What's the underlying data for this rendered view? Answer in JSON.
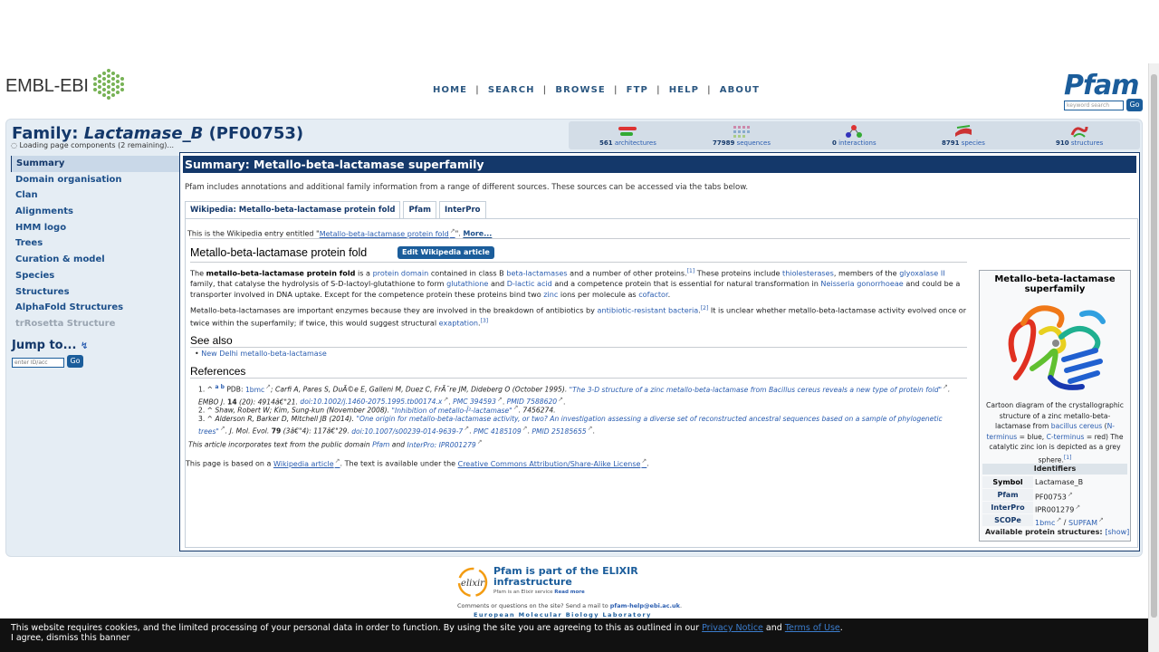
{
  "header": {
    "ebi_logo_text": "EMBL-EBI",
    "nav": [
      "HOME",
      "SEARCH",
      "BROWSE",
      "FTP",
      "HELP",
      "ABOUT"
    ],
    "nav_separator": "|",
    "pfam_logo_text": "Pfam",
    "search_placeholder": "keyword search",
    "search_go": "Go"
  },
  "family": {
    "title_prefix": "Family:",
    "name": "Lactamase_B",
    "accession": "(PF00753)",
    "loading": "Loading page components (2 remaining)..."
  },
  "stats": [
    {
      "count": "561",
      "label": "architectures",
      "icon": "architectures-icon"
    },
    {
      "count": "77989",
      "label": "sequences",
      "icon": "sequences-icon"
    },
    {
      "count": "0",
      "label": "interactions",
      "icon": "interactions-icon"
    },
    {
      "count": "8791",
      "label": "species",
      "icon": "species-icon"
    },
    {
      "count": "910",
      "label": "structures",
      "icon": "structures-icon"
    }
  ],
  "sidebar": {
    "items": [
      {
        "label": "Summary"
      },
      {
        "label": "Domain organisation"
      },
      {
        "label": "Clan"
      },
      {
        "label": "Alignments"
      },
      {
        "label": "HMM logo"
      },
      {
        "label": "Trees"
      },
      {
        "label": "Curation & model"
      },
      {
        "label": "Species"
      },
      {
        "label": "Structures"
      },
      {
        "label": "AlphaFold Structures"
      },
      {
        "label": "trRosetta Structure"
      }
    ],
    "jump_title": "Jump to...",
    "jump_placeholder": "enter ID/acc",
    "jump_go": "Go"
  },
  "main": {
    "heading": "Summary: Metallo-beta-lactamase superfamily",
    "intro": "Pfam includes annotations and additional family information from a range of different sources. These sources can be accessed via the tabs below.",
    "tabs": [
      "Wikipedia: Metallo-beta-lactamase protein fold",
      "Pfam",
      "InterPro"
    ],
    "wiki_entry_prefix": "This is the Wikipedia entry entitled \"",
    "wiki_entry_link": "Metallo-beta-lactamase protein fold",
    "wiki_entry_suffix": "\".",
    "more": "More...",
    "article_title": "Metallo-beta-lactamase protein fold",
    "edit_button": "Edit Wikipedia article",
    "para1": {
      "t1": "The ",
      "b1": "metallo-beta-lactamase protein fold",
      "t2": " is a ",
      "l1": "protein domain",
      "t3": " contained in class B ",
      "l2": "beta-lactamases",
      "t4": " and a number of other proteins.",
      "s1": "[1]",
      "t5": " These proteins include ",
      "l3": "thiolesterases",
      "t6": ", members of the ",
      "l4": "glyoxalase II",
      "t7": " family, that catalyse the hydrolysis of S-D-lactoyl-glutathione to form ",
      "l5": "glutathione",
      "t8": " and ",
      "l6": "D-lactic acid",
      "t9": " and a competence protein that is essential for natural transformation in ",
      "l7": "Neisseria gonorrhoeae",
      "t10": " and could be a transporter involved in DNA uptake. Except for the competence protein these proteins bind two ",
      "l8": "zinc",
      "t11": " ions per molecule as ",
      "l9": "cofactor",
      "t12": "."
    },
    "para2": {
      "t1": "Metallo-beta-lactamases are important enzymes because they are involved in the breakdown of antibiotics by ",
      "l1": "antibiotic-resistant bacteria",
      "t2": ".",
      "s1": "[2]",
      "t3": " It is unclear whether metallo-beta-lactamase activity evolved once or twice within the superfamily; if twice, this would suggest structural ",
      "l2": "exaptation",
      "t4": ".",
      "s2": "[3]"
    },
    "see_also_title": "See also",
    "see_also_items": [
      "New Delhi metallo-beta-lactamase"
    ],
    "references_title": "References",
    "refs": [
      {
        "num": "1.",
        "caret": "^",
        "ab": "a b",
        "pre": "PDB: ",
        "pdb": "1bmc",
        "authors": "; Carfi A, Pares S, DuÃ©e E, Galleni M, Duez C, FrÃ¨re JM, Dideberg O (October 1995). ",
        "title": "\"The 3-D structure of a zinc metallo-beta-lactamase from Bacillus cereus reveals a new type of protein fold\"",
        "journal": ". EMBO J. ",
        "vol": "14",
        "pages": " (20): 4914â€\"21. ",
        "doi": "doi:10.1002/j.1460-2075.1995.tb00174.x",
        "pmc": "PMC 394593",
        "pmid": "PMID 7588620"
      },
      {
        "num": "2.",
        "caret": "^",
        "authors": "Shaw, Robert W; Kim, Sung-kun (November 2008). ",
        "title": "\"Inhibition of metallo-Î²-lactamase\"",
        "tail": ". 7456274."
      },
      {
        "num": "3.",
        "caret": "^",
        "authors": "Alderson R, Barker D, Mitchell JB (2014). ",
        "title": "\"One origin for metallo-beta-lactamase activity, or two? An investigation assessing a diverse set of reconstructed ancestral sequences based on a sample of phylogenetic trees\"",
        "journal": ". J. Mol. Evol. ",
        "vol": "79",
        "pages": " (3â€\"4): 117â€\"29. ",
        "doi": "doi:10.1007/s00239-014-9639-7",
        "pmc": "PMC 4185109",
        "pmid": "PMID 25185655"
      }
    ],
    "incorporates_pre": "This article incorporates text from the public domain ",
    "incorporates_pfam": "Pfam",
    "incorporates_and": " and ",
    "incorporates_interpro": "InterPro: IPR001279",
    "based_pre": "This page is based on a ",
    "based_link": "Wikipedia article",
    "based_mid": ". The text is available under the ",
    "based_license": "Creative Commons Attribution/Share-Alike License",
    "based_end": "."
  },
  "infobox": {
    "title": "Metallo-beta-lactamase superfamily",
    "caption_pre": "Cartoon diagram of the crystallographic structure of a zinc metallo-beta-lactamase from ",
    "caption_l1": "bacillus cereus",
    "caption_m1": " (",
    "caption_l2": "N-terminus",
    "caption_m2": " = blue, ",
    "caption_l3": "C-terminus",
    "caption_m3": " = red) The catalytic zinc ion is depicted as a grey sphere.",
    "caption_sup": "[1]",
    "identifiers_title": "Identifiers",
    "rows": [
      {
        "key": "Symbol",
        "value": "Lactamase_B"
      },
      {
        "key": "Pfam",
        "value": "PF00753"
      },
      {
        "key": "InterPro",
        "value": "IPR001279"
      },
      {
        "key": "SCOPe",
        "value": "1bmc",
        "value2": "SUPFAM"
      }
    ],
    "scope_sep": " / ",
    "available": "Available protein structures:",
    "show": "[show]"
  },
  "footer": {
    "title": "Pfam is part of the ELIXIR infrastructure",
    "small": "Pfam is an Elixir service",
    "read_more": "Read more",
    "mail_pre": "Comments or questions on the site? Send a mail to ",
    "mail": "pfam-help@ebi.ac.uk",
    "mail_end": ".",
    "embl": "European Molecular Biology Laboratory"
  },
  "cookie": {
    "text_pre": "This website requires cookies, and the limited processing of your personal data in order to function. By using the site you are agreeing to this as outlined in our ",
    "privacy": "Privacy Notice",
    "and": " and ",
    "terms": "Terms of Use",
    "end": ".",
    "dismiss": "I agree, dismiss this banner"
  },
  "colors": {
    "brand_dark": "#14386a",
    "brand_blue": "#1b5d9b",
    "link": "#2a5db0",
    "ebi_green": "#77b255"
  }
}
